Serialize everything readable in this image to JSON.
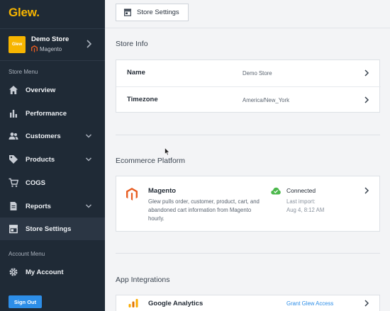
{
  "sidebar": {
    "logo": "Glew.",
    "store": {
      "badge": "Glew",
      "name": "Demo Store",
      "platform": "Magento"
    },
    "store_menu_label": "Store Menu",
    "items": [
      {
        "label": "Overview",
        "icon": "home-icon"
      },
      {
        "label": "Performance",
        "icon": "bar-chart-icon"
      },
      {
        "label": "Customers",
        "icon": "users-icon"
      },
      {
        "label": "Products",
        "icon": "tag-icon"
      },
      {
        "label": "COGS",
        "icon": "cart-icon"
      },
      {
        "label": "Reports",
        "icon": "document-icon"
      },
      {
        "label": "Store Settings",
        "icon": "storefront-icon",
        "active": true
      }
    ],
    "account_menu_label": "Account Menu",
    "account_items": [
      {
        "label": "My Account",
        "icon": "gear-icon"
      }
    ],
    "sign_out": "Sign Out"
  },
  "header": {
    "tab": "Store Settings"
  },
  "store_info": {
    "title": "Store Info",
    "rows": [
      {
        "label": "Name",
        "value": "Demo Store"
      },
      {
        "label": "Timezone",
        "value": "America/New_York"
      }
    ]
  },
  "ecommerce": {
    "title": "Ecommerce Platform",
    "name": "Magento",
    "description": "Glew pulls order, customer, product, cart, and abandoned cart information from Magento hourly.",
    "status": "Connected",
    "last_import_label": "Last import:",
    "last_import_value": "Aug 4, 8:12 AM"
  },
  "integrations": {
    "title": "App Integrations",
    "items": [
      {
        "name": "Google Analytics",
        "action": "Grant Glew Access"
      }
    ]
  },
  "colors": {
    "sidebar": "#1f2a36",
    "accent": "#f7b500",
    "link": "#2d8ee8",
    "connected": "#4cb84c",
    "magento": "#e85d22"
  }
}
